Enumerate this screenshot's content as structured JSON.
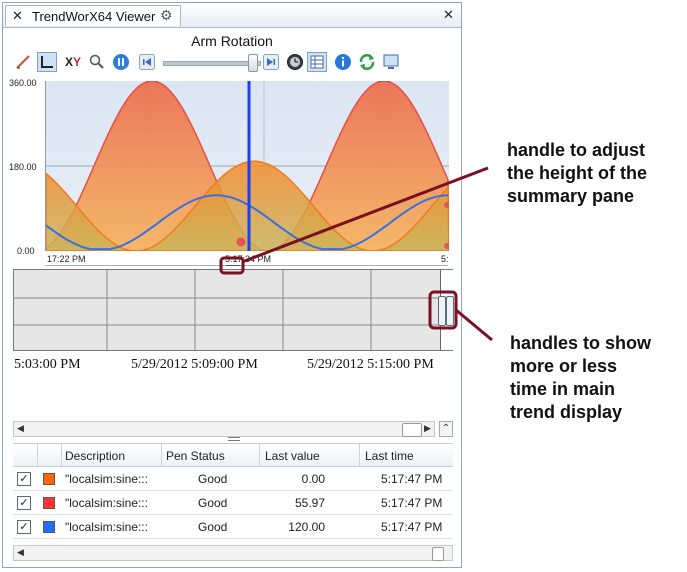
{
  "tab": {
    "title": "TrendWorX64 Viewer",
    "close": "✕",
    "window_close": "✕"
  },
  "chart": {
    "title": "Arm Rotation"
  },
  "toolbar": {
    "icons": [
      "pen-icon",
      "axes-icon",
      "xy-icon",
      "zoom-icon",
      "pause-icon",
      "rewind-icon",
      "forward-icon",
      "clock-icon",
      "grid-icon",
      "info-icon",
      "refresh-icon",
      "display-icon"
    ]
  },
  "y_axis": {
    "top": "360.00",
    "mid": "180.00",
    "bottom": "0.00"
  },
  "x_axis": {
    "start": "17:22 PM",
    "mid": "5:17:34 PM",
    "end": "5:"
  },
  "overview": {
    "labels": [
      "5:03:00 PM",
      "5/29/2012 5:09:00 PM",
      "5/29/2012 5:15:00 PM"
    ]
  },
  "chart_data": {
    "type": "area",
    "title": "Arm Rotation",
    "ylim": [
      0,
      360
    ],
    "y_ticks": [
      "0.00",
      "180.00",
      "360.00"
    ],
    "x_ticks": [
      "17:22 PM",
      "5:17:34 PM",
      "5:"
    ],
    "series": [
      {
        "color": "#e84a3a"
      },
      {
        "color": "#f08a24"
      },
      {
        "color": "#3b6fe0"
      }
    ],
    "grid": true
  },
  "table": {
    "headers": [
      "Description",
      "Pen Status",
      "Last value",
      "Last time"
    ],
    "rows": [
      {
        "checked": "✓",
        "color": "#ff6600",
        "description": "\"localsim:sine:::",
        "status": "Good",
        "value": "0.00",
        "time": "5:17:47 PM"
      },
      {
        "checked": "✓",
        "color": "#ff3333",
        "description": "\"localsim:sine:::",
        "status": "Good",
        "value": "55.97",
        "time": "5:17:47 PM"
      },
      {
        "checked": "✓",
        "color": "#1f6fff",
        "description": "\"localsim:sine:::",
        "status": "Good",
        "value": "120.00",
        "time": "5:17:47 PM"
      }
    ]
  },
  "annotations": {
    "pane_handle": [
      "handle to adjust",
      "the height of the",
      "summary pane"
    ],
    "time_handles": [
      "handles to show",
      "more or less",
      "time in main",
      "trend display"
    ]
  }
}
